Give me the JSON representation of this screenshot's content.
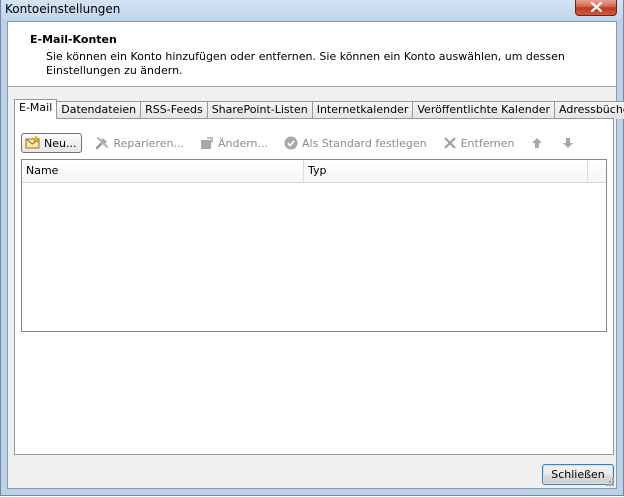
{
  "window": {
    "title": "Kontoeinstellungen"
  },
  "header": {
    "title": "E-Mail-Konten",
    "description": "Sie können ein Konto hinzufügen oder entfernen. Sie können ein Konto auswählen, um dessen Einstellungen zu ändern."
  },
  "tabs": [
    {
      "label": "E-Mail",
      "active": true
    },
    {
      "label": "Datendateien"
    },
    {
      "label": "RSS-Feeds"
    },
    {
      "label": "SharePoint-Listen"
    },
    {
      "label": "Internetkalender"
    },
    {
      "label": "Veröffentlichte Kalender"
    },
    {
      "label": "Adressbücher"
    }
  ],
  "toolbar": {
    "new_label": "Neu...",
    "repair_label": "Reparieren...",
    "change_label": "Ändern...",
    "default_label": "Als Standard festlegen",
    "remove_label": "Entfernen"
  },
  "list": {
    "columns": [
      "Name",
      "Typ"
    ],
    "rows": []
  },
  "footer": {
    "close_label": "Schließen"
  },
  "colors": {
    "accent": "#3c7fb1",
    "disabled_text": "#8c8c8c",
    "window_frame": "#bcd0e6"
  }
}
